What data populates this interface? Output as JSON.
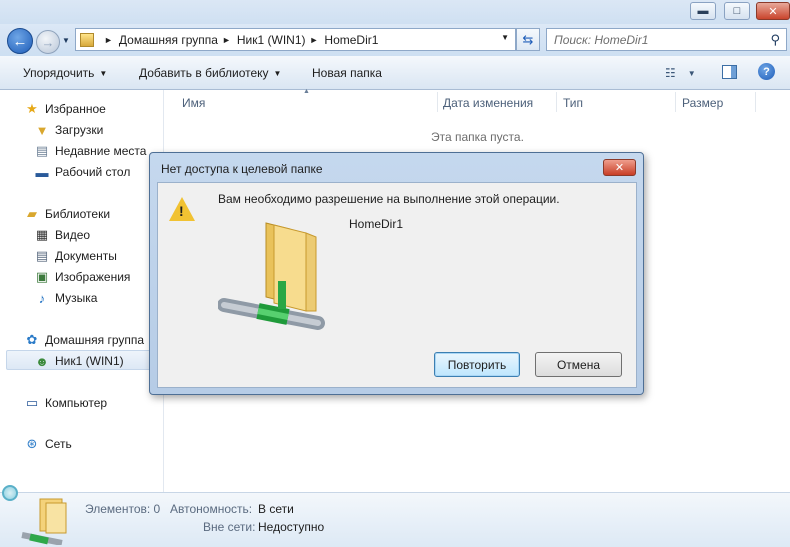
{
  "window": {
    "min_glyph": "▬",
    "max_glyph": "□",
    "close_glyph": "✕"
  },
  "address": {
    "crumbs": [
      "Домашняя группа",
      "Ник1 (WIN1)",
      "HomeDir1"
    ]
  },
  "search": {
    "placeholder": "Поиск: HomeDir1"
  },
  "toolbar": {
    "organize": "Упорядочить",
    "add_to_library": "Добавить в библиотеку",
    "new_folder": "Новая папка"
  },
  "nav": {
    "favorites": "Избранное",
    "downloads": "Загрузки",
    "recent": "Недавние места",
    "desktop": "Рабочий стол",
    "libraries": "Библиотеки",
    "video": "Видео",
    "documents": "Документы",
    "images": "Изображения",
    "music": "Музыка",
    "homegroup": "Домашняя группа",
    "user": "Ник1 (WIN1)",
    "computer": "Компьютер",
    "network": "Сеть"
  },
  "columns": {
    "name": "Имя",
    "date": "Дата изменения",
    "type": "Тип",
    "size": "Размер"
  },
  "empty_message": "Эта папка пуста.",
  "dialog": {
    "title": "Нет доступа к целевой папке",
    "message": "Вам необходимо разрешение на выполнение этой операции.",
    "folder_name": "HomeDir1",
    "retry": "Повторить",
    "cancel": "Отмена"
  },
  "details": {
    "items_label": "Элементов: 0",
    "offline_label": "Автономность:",
    "offline_value": "В сети",
    "network_label": "Вне сети:",
    "network_value": "Недоступно"
  }
}
